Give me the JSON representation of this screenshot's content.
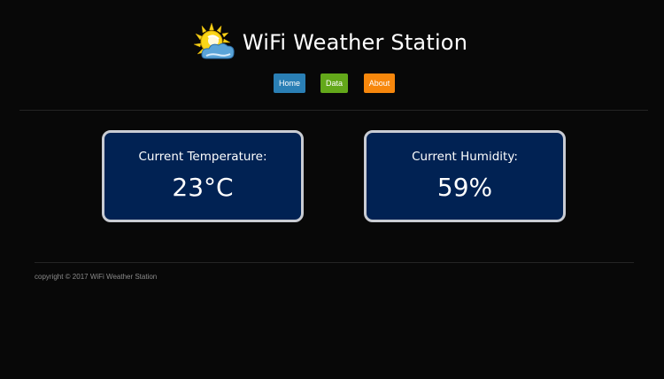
{
  "header": {
    "title": "WiFi Weather Station",
    "logo_icon": "sun-cloud-icon"
  },
  "nav": {
    "home_label": "Home",
    "data_label": "Data",
    "about_label": "About",
    "home_color": "#2a7fb5",
    "data_color": "#63a81a",
    "about_color": "#f7870c"
  },
  "cards": {
    "temperature": {
      "label": "Current Temperature:",
      "value": "23°C"
    },
    "humidity": {
      "label": "Current Humidity:",
      "value": "59%"
    },
    "background_color": "#012253",
    "border_color": "#c9ccd3"
  },
  "footer": {
    "copyright": "copyright © 2017 WiFi Weather Station"
  }
}
